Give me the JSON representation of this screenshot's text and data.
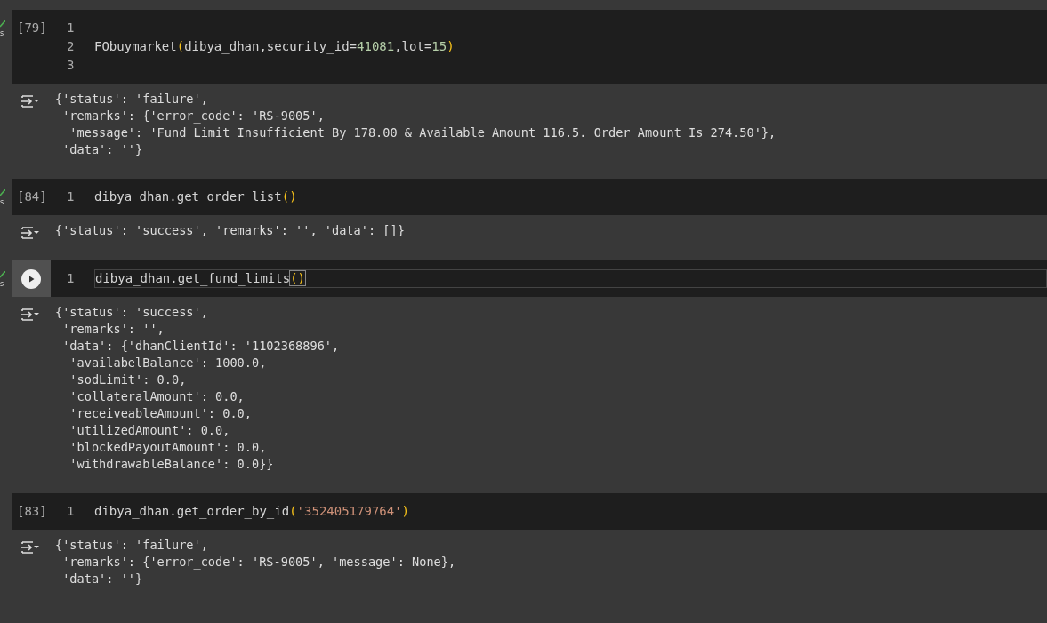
{
  "cells": [
    {
      "check": true,
      "gutter_text": "s",
      "execution_count": "[79]",
      "focused": false,
      "lines": [
        {
          "number": "1"
        },
        {
          "number": "2",
          "tokens": [
            {
              "kind": "plain",
              "text": "FObuymarket"
            },
            {
              "kind": "paren",
              "text": "("
            },
            {
              "kind": "plain",
              "text": "dibya_dhan,security_id="
            },
            {
              "kind": "number",
              "text": "41081"
            },
            {
              "kind": "plain",
              "text": ",lot="
            },
            {
              "kind": "number",
              "text": "15"
            },
            {
              "kind": "paren",
              "text": ")"
            }
          ]
        },
        {
          "number": "3"
        }
      ],
      "output": [
        "{'status': 'failure',",
        " 'remarks': {'error_code': 'RS-9005',",
        "  'message': 'Fund Limit Insufficient By 178.00 & Available Amount 116.5. Order Amount Is 274.50'},",
        " 'data': ''}"
      ]
    },
    {
      "check": true,
      "gutter_text": "s",
      "execution_count": "[84]",
      "focused": false,
      "lines": [
        {
          "number": "1",
          "tokens": [
            {
              "kind": "plain",
              "text": "dibya_dhan.get_order_list"
            },
            {
              "kind": "paren",
              "text": "()"
            }
          ]
        }
      ],
      "output": [
        "{'status': 'success', 'remarks': '', 'data': []}"
      ]
    },
    {
      "check": true,
      "gutter_text": "s",
      "run_button": true,
      "focused": true,
      "lines": [
        {
          "number": "1",
          "tokens": [
            {
              "kind": "plain",
              "text": "dibya_dhan.get_fund_limits"
            },
            {
              "kind": "paren_match",
              "text": "()"
            }
          ]
        }
      ],
      "output": [
        "{'status': 'success',",
        " 'remarks': '',",
        " 'data': {'dhanClientId': '1102368896',",
        "  'availabelBalance': 1000.0,",
        "  'sodLimit': 0.0,",
        "  'collateralAmount': 0.0,",
        "  'receiveableAmount': 0.0,",
        "  'utilizedAmount': 0.0,",
        "  'blockedPayoutAmount': 0.0,",
        "  'withdrawableBalance': 0.0}}"
      ]
    },
    {
      "check": false,
      "execution_count": "[83]",
      "focused": false,
      "lines": [
        {
          "number": "1",
          "tokens": [
            {
              "kind": "plain",
              "text": "dibya_dhan.get_order_by_id"
            },
            {
              "kind": "paren",
              "text": "("
            },
            {
              "kind": "string",
              "text": "'352405179764'"
            },
            {
              "kind": "paren",
              "text": ")"
            }
          ]
        }
      ],
      "output": [
        "{'status': 'failure',",
        " 'remarks': {'error_code': 'RS-9005', 'message': None},",
        " 'data': ''}"
      ]
    }
  ]
}
